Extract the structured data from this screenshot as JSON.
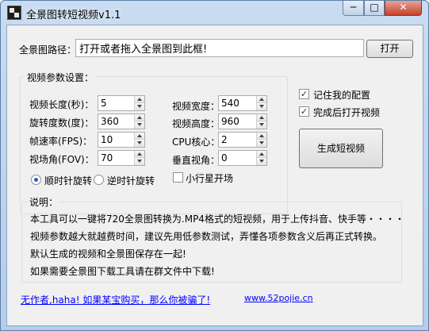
{
  "window": {
    "title": "全景图转短视频v1.1",
    "controls": {
      "minimize": "─",
      "maximize": "□",
      "close": "✕"
    }
  },
  "path": {
    "label": "全景图路径：",
    "value": "打开或者拖入全景图到此框!",
    "open_button": "打开"
  },
  "video_settings": {
    "group_title": "视频参数设置：",
    "fields": {
      "length": {
        "label": "视频长度(秒)：",
        "value": "5"
      },
      "rotation": {
        "label": "旋转度数(度)：",
        "value": "360"
      },
      "fps": {
        "label": "帧速率(FPS)：",
        "value": "10"
      },
      "fov": {
        "label": "视场角(FOV)：",
        "value": "70"
      },
      "width": {
        "label": "视频宽度：",
        "value": "540"
      },
      "height": {
        "label": "视频高度：",
        "value": "960"
      },
      "cpu": {
        "label": "CPU核心：",
        "value": "2"
      },
      "pitch": {
        "label": "垂直视角：",
        "value": "0"
      }
    },
    "direction": {
      "clockwise": "顺时针旋转",
      "counterclockwise": "逆时针旋转",
      "selected": "clockwise"
    },
    "little_planet": {
      "label": "小行星开场",
      "checked": false
    }
  },
  "options": {
    "remember": {
      "label": "记住我的配置",
      "checked": true
    },
    "open_after": {
      "label": "完成后打开视频",
      "checked": true
    }
  },
  "generate_button": "生成短视频",
  "description": {
    "title": "说明：",
    "lines": [
      "本工具可以一键将720全景图转换为.MP4格式的短视频，用于上传抖音、快手等・・・・",
      "视频参数越大就越费时间，建议先用低参数测试，弄懂各项参数含义后再正式转换。",
      "默认生成的视频和全景图保存在一起!",
      "如果需要全景图下载工具请在群文件中下载!"
    ]
  },
  "footer": {
    "author_text": "无作者,haha! 如果某宝购买，那么你被骗了!",
    "website": "www.52pojie.cn"
  },
  "colors": {
    "title_bar": "#b9cfea",
    "close_button": "#c7402a",
    "link": "#0000ff"
  }
}
